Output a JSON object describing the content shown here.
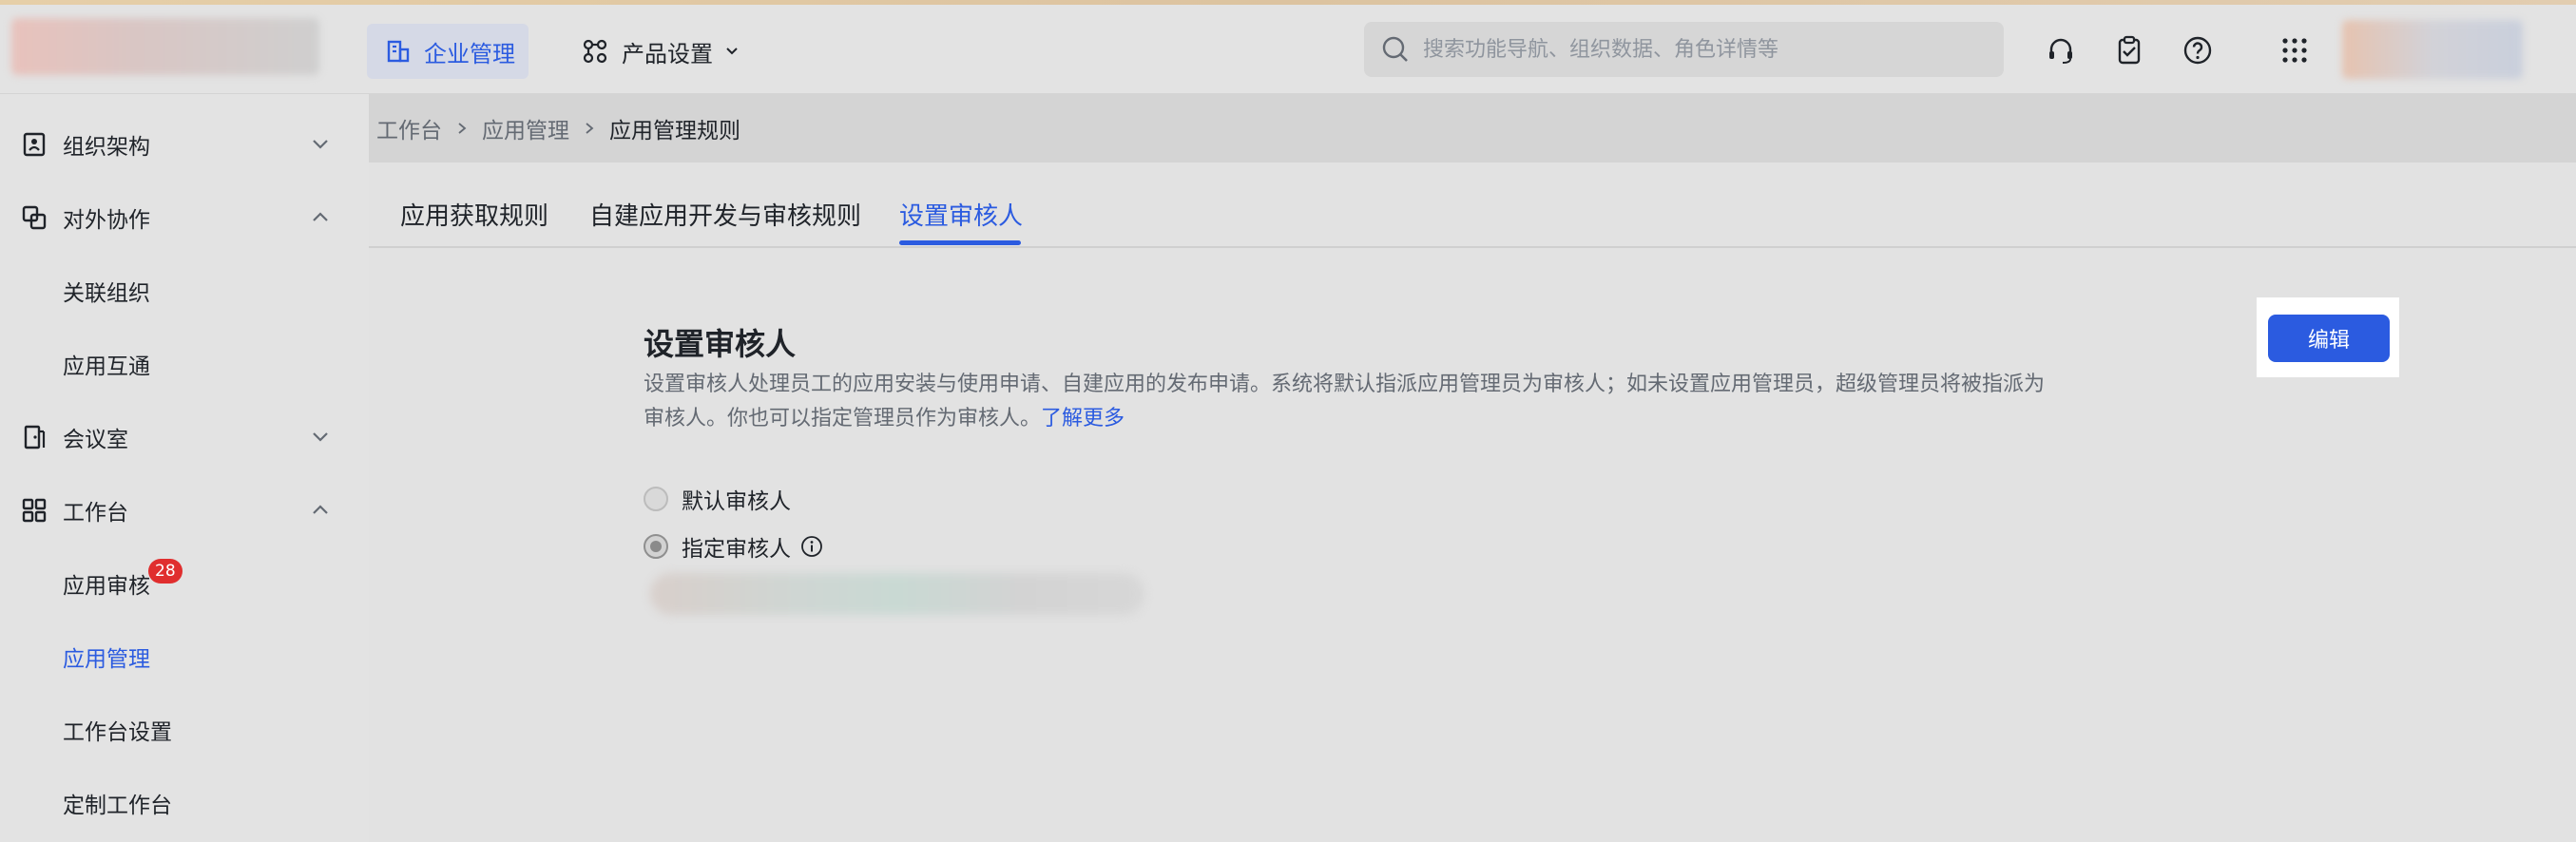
{
  "header": {
    "nav_tabs": [
      {
        "label": "企业管理",
        "active": true,
        "icon": "building-icon"
      },
      {
        "label": "产品设置",
        "active": false,
        "icon": "apps-icon"
      }
    ],
    "search": {
      "placeholder": "搜索功能导航、组织数据、角色详情等"
    },
    "icons": [
      "headset-icon",
      "clipboard-icon",
      "help-icon",
      "grid-menu-icon"
    ]
  },
  "sidebar": {
    "items": [
      {
        "label": "组织架构",
        "icon": "contact-card-icon",
        "expanded": false
      },
      {
        "label": "对外协作",
        "icon": "collaboration-icon",
        "expanded": true
      },
      {
        "label": "关联组织",
        "sub": true
      },
      {
        "label": "应用互通",
        "sub": true
      },
      {
        "label": "会议室",
        "icon": "door-icon",
        "expanded": false
      },
      {
        "label": "工作台",
        "icon": "grid-icon",
        "expanded": true
      },
      {
        "label": "应用审核",
        "sub": true,
        "badge": "28"
      },
      {
        "label": "应用管理",
        "sub": true,
        "selected": true
      },
      {
        "label": "工作台设置",
        "sub": true
      },
      {
        "label": "定制工作台",
        "sub": true
      }
    ]
  },
  "breadcrumb": [
    "工作台",
    "应用管理",
    "应用管理规则"
  ],
  "tabs": [
    {
      "label": "应用获取规则",
      "active": false
    },
    {
      "label": "自建应用开发与审核规则",
      "active": false
    },
    {
      "label": "设置审核人",
      "active": true
    }
  ],
  "section": {
    "title": "设置审核人",
    "desc_line1": "设置审核人处理员工的应用安装与使用申请、自建应用的发布申请。系统将默认指派应用管理员为审核人；如未设置应用管理员，超级管理员将被指派为",
    "desc_line2": "审核人。你也可以指定管理员作为审核人。",
    "link": "了解更多",
    "edit_label": "编辑",
    "options": [
      {
        "label": "默认审核人",
        "checked": false
      },
      {
        "label": "指定审核人",
        "checked": true
      }
    ]
  },
  "colors": {
    "accent": "#2b5be0",
    "badge": "#e02e2e"
  }
}
